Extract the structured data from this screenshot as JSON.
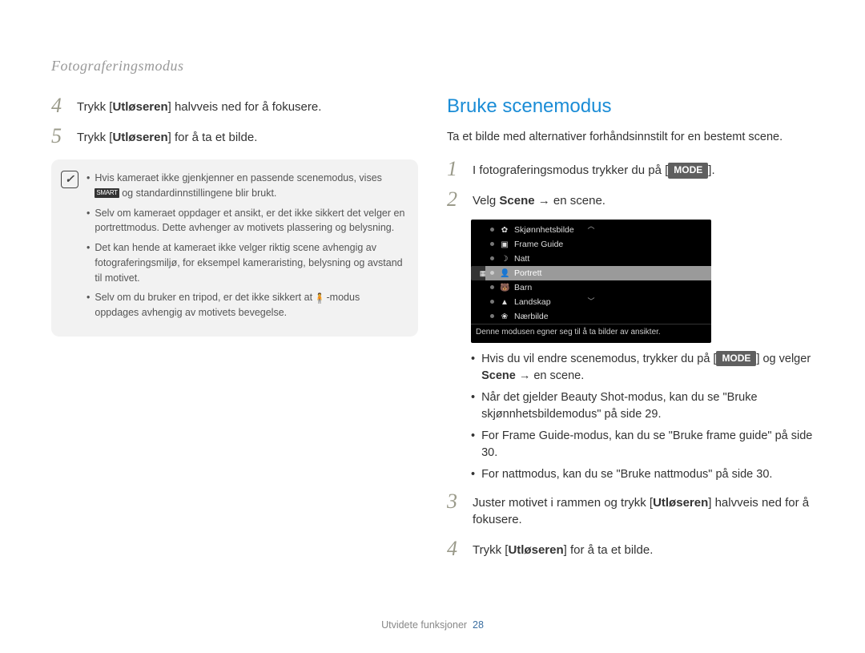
{
  "header": "Fotograferingsmodus",
  "left": {
    "step4": {
      "num": "4",
      "before": "Trykk [",
      "bold": "Utløseren",
      "after": "] halvveis ned for å fokusere."
    },
    "step5": {
      "num": "5",
      "before": "Trykk [",
      "bold": "Utløseren",
      "after": "] for å ta et bilde."
    },
    "note": {
      "items": [
        {
          "pre": "Hvis kameraet ikke gjenkjenner en passende scenemodus, vises ",
          "icon_label": "SMART",
          "post": " og standardinnstillingene blir brukt."
        },
        {
          "text": "Selv om kameraet oppdager et ansikt, er det ikke sikkert det velger en portrettmodus. Dette avhenger av motivets plassering og belysning."
        },
        {
          "text": "Det kan hende at kameraet ikke velger riktig scene avhengig av fotograferingsmiljø, for eksempel kameraristing, belysning og avstand til motivet."
        },
        {
          "pre": "Selv om du bruker en tripod, er det ikke sikkert at ",
          "post": "-modus oppdages avhengig av motivets bevegelse."
        }
      ]
    }
  },
  "right": {
    "title": "Bruke scenemodus",
    "intro": "Ta et bilde med alternativer forhåndsinnstilt for en bestemt scene.",
    "step1": {
      "num": "1",
      "before": "I fotograferingsmodus trykker du på [",
      "badge": "MODE",
      "after": "]."
    },
    "step2": {
      "num": "2",
      "before": "Velg ",
      "bold": "Scene",
      "after": " → en scene."
    },
    "scene_menu": {
      "items": [
        {
          "icon": "✿",
          "label": "Skjønnhetsbilde"
        },
        {
          "icon": "▣",
          "label": "Frame Guide"
        },
        {
          "icon": "☽",
          "label": "Natt"
        },
        {
          "icon": "👤",
          "label": "Portrett",
          "selected": true
        },
        {
          "icon": "🐻",
          "label": "Barn"
        },
        {
          "icon": "▲",
          "label": "Landskap"
        },
        {
          "icon": "❀",
          "label": "Nærbilde"
        }
      ],
      "caption": "Denne modusen egner seg til å ta bilder av ansikter."
    },
    "sub_bullets": [
      {
        "pre": "Hvis du vil endre scenemodus, trykker du på [",
        "badge": "MODE",
        "mid": "] og velger ",
        "bold": "Scene",
        "post": " → en scene."
      },
      {
        "text": "Når det gjelder Beauty Shot-modus, kan du se \"Bruke skjønnhetsbildemodus\" på side 29."
      },
      {
        "text": "For Frame Guide-modus, kan du se \"Bruke frame guide\" på side 30."
      },
      {
        "text": "For nattmodus, kan du se \"Bruke nattmodus\" på side 30."
      }
    ],
    "step3": {
      "num": "3",
      "before": "Juster motivet i rammen og trykk [",
      "bold": "Utløseren",
      "after": "] halvveis ned for å fokusere."
    },
    "step4": {
      "num": "4",
      "before": "Trykk [",
      "bold": "Utløseren",
      "after": "] for å ta et bilde."
    }
  },
  "footer": {
    "label": "Utvidete funksjoner",
    "page": "28"
  }
}
